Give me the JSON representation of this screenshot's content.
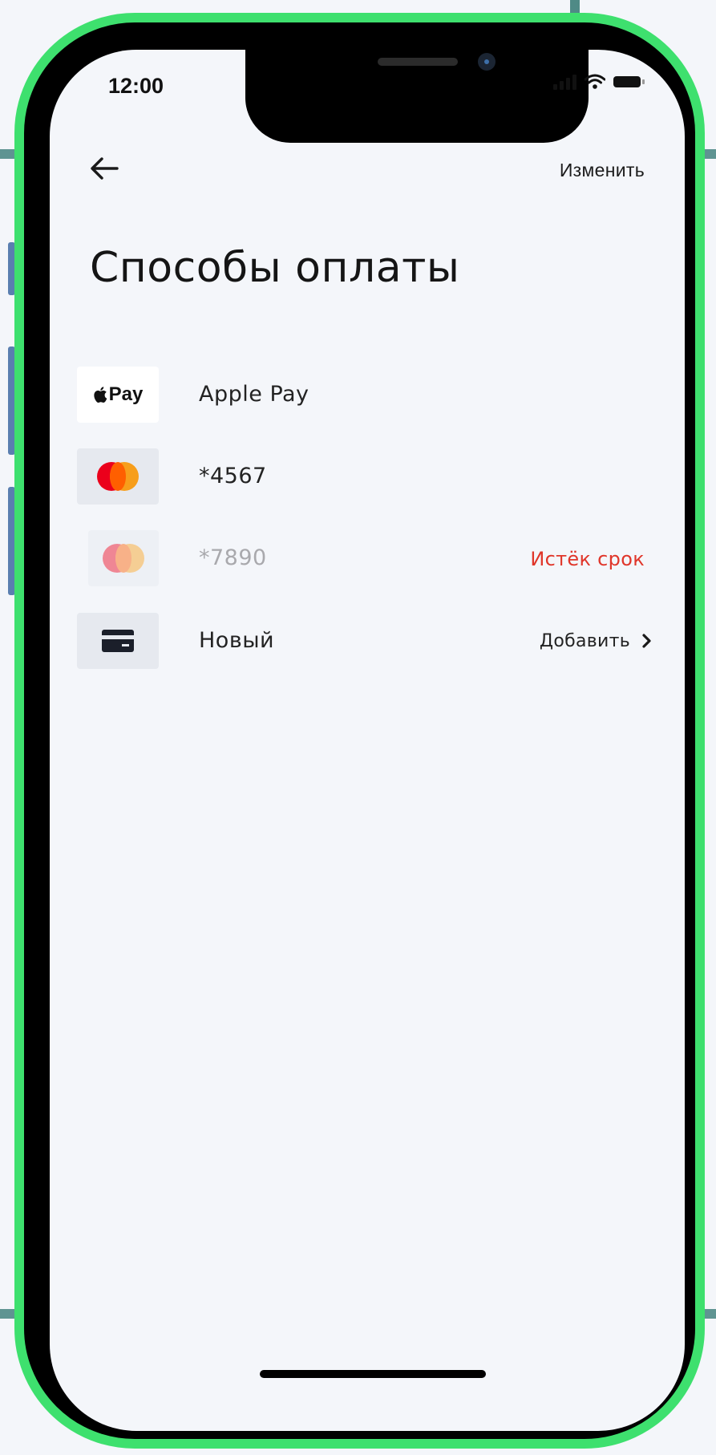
{
  "status_bar": {
    "time": "12:00",
    "icons": [
      "signal-icon",
      "wifi-icon",
      "battery-icon"
    ]
  },
  "header": {
    "back_icon": "arrow-left-icon",
    "edit_label": "Изменить",
    "title": "Способы оплаты"
  },
  "payment_methods": [
    {
      "logo": "Pay",
      "logo_icon": "apple-logo-icon",
      "label": "Apple Pay",
      "action": ""
    },
    {
      "logo_icon": "mastercard-icon",
      "label": "*4567",
      "action": ""
    },
    {
      "logo_icon": "mastercard-icon",
      "label": "*7890",
      "action": "Истёк срок",
      "action_color": "#e0362a",
      "expired": true
    },
    {
      "logo_icon": "card-icon",
      "label": "Новый",
      "action": "Добавить",
      "action_icon": "chevron-right-icon"
    }
  ],
  "colors": {
    "frame": "#3ee06e",
    "background": "#f4f6fa",
    "error": "#e0362a"
  }
}
